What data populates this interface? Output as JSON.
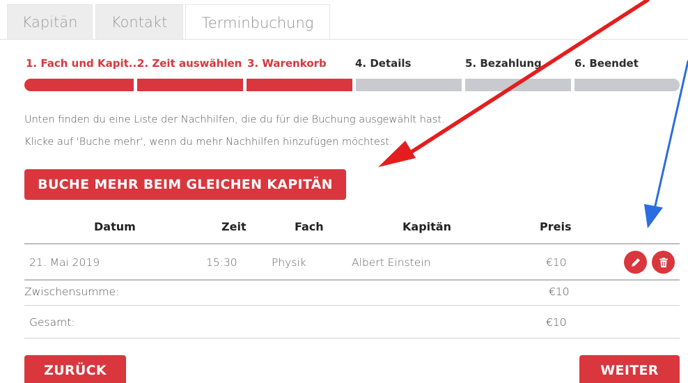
{
  "tabs": [
    "Kapitän",
    "Kontakt",
    "Terminbuchung"
  ],
  "steps": [
    "1. Fach und Kapit...",
    "2. Zeit auswählen",
    "3. Warenkorb",
    "4. Details",
    "5. Bezahlung",
    "6. Beendet"
  ],
  "info": {
    "line1": "Unten finden du eine Liste der Nachhilfen, die du für die Buchung ausgewählt hast.",
    "line2": "Klicke auf 'Buche mehr', wenn du mehr Nachhilfen hinzufügen möchtest."
  },
  "buttons": {
    "more": "BUCHE MEHR BEIM GLEICHEN KAPITÄN",
    "back": "ZURÜCK",
    "next": "WEITER"
  },
  "table": {
    "headers": [
      "Datum",
      "Zeit",
      "Fach",
      "Kapitän",
      "Preis"
    ],
    "row": {
      "date": "21. Mai 2019",
      "time": "15:30",
      "subject": "Physik",
      "captain": "Albert Einstein",
      "price": "€10"
    },
    "subtotal_label": "Zwischensumme:",
    "subtotal_value": "€10",
    "total_label": "Gesamt:",
    "total_value": "€10"
  },
  "icons": {
    "edit": "pencil-icon",
    "delete": "trash-icon"
  },
  "colors": {
    "accent": "#d9363e",
    "inactive_step": "#c9cad0",
    "arrow_red": "#e41e1e",
    "arrow_blue": "#2a6de0"
  }
}
